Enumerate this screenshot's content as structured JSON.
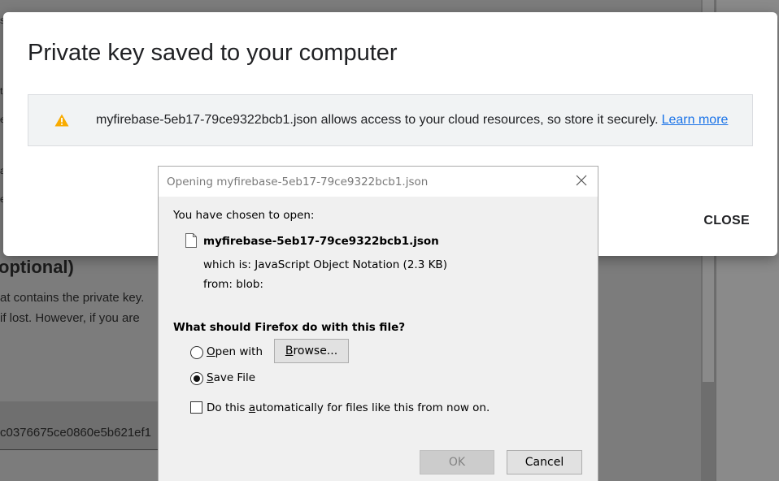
{
  "background": {
    "heading": "optional)",
    "line1": "at contains the private key.",
    "line2": " if lost. However, if you are",
    "key_id": "c0376675ce0860e5b621ef1"
  },
  "main_dialog": {
    "title": "Private key saved to your computer",
    "notice_text": "myfirebase-5eb17-79ce9322bcb1.json allows access to your cloud resources, so store it securely.",
    "learn_more": "Learn more",
    "close_label": "CLOSE",
    "warning_icon": "warning-icon"
  },
  "download_dialog": {
    "title": "Opening myfirebase-5eb17-79ce9322bcb1.json",
    "chosen_label": "You have chosen to open:",
    "filename": "myfirebase-5eb17-79ce9322bcb1.json",
    "which_is_label": "which is:",
    "which_is_value": "JavaScript Object Notation (2.3 KB)",
    "from_label": "from:",
    "from_value": "blob:",
    "question": "What should Firefox do with this file?",
    "open_with_pre": "",
    "open_with_u": "O",
    "open_with_post": "pen with",
    "browse_pre": "",
    "browse_u": "B",
    "browse_post": "rowse...",
    "save_file_pre": "",
    "save_file_u": "S",
    "save_file_post": "ave File",
    "auto_pre": "Do this ",
    "auto_u": "a",
    "auto_post": "utomatically for files like this from now on.",
    "ok_label": "OK",
    "cancel_label": "Cancel",
    "selected_option": "Save File",
    "auto_checked": false
  },
  "colors": {
    "link": "#1a73e8",
    "warning": "#f9ab00",
    "overlay": "#7c7c7c"
  }
}
